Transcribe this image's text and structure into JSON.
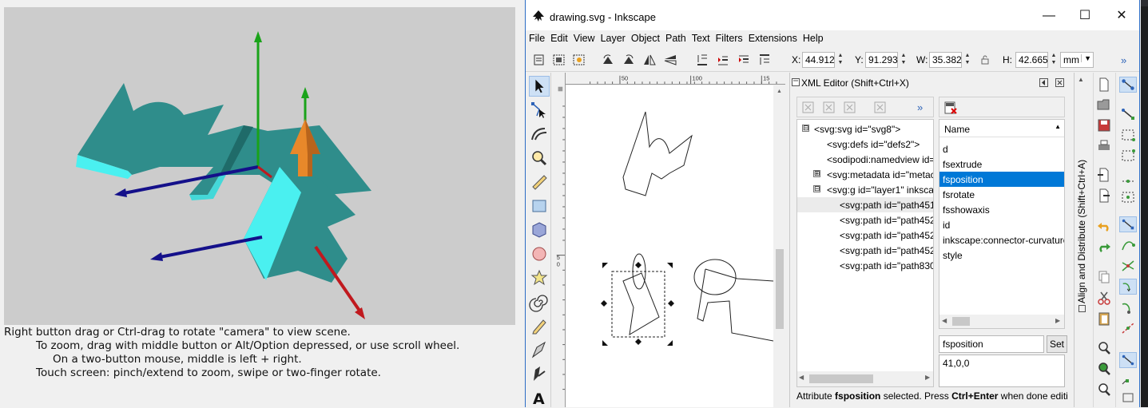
{
  "viewer": {
    "instructions": [
      "Right button drag or Ctrl-drag to rotate \"camera\" to view scene.",
      "To zoom, drag with middle button or Alt/Option depressed, or use scroll wheel.",
      "On a two-button mouse, middle is left + right.",
      "Touch screen: pinch/extend to zoom, swipe or two-finger rotate."
    ],
    "colors": {
      "background": "#cccccc",
      "shape_dark": "#2f8d8b",
      "shape_light": "#4af0f0",
      "x_axis": "#c0191e",
      "y_axis": "#1aa31a",
      "z_axis": "#14108a",
      "arrow": "#e8882a"
    }
  },
  "inkscape": {
    "title": "drawing.svg - Inkscape",
    "window_controls": {
      "minimize": "—",
      "maximize": "☐",
      "close": "✕"
    },
    "menu": [
      "File",
      "Edit",
      "View",
      "Layer",
      "Object",
      "Path",
      "Text",
      "Filters",
      "Extensions",
      "Help"
    ],
    "coords": {
      "x_label": "X:",
      "x_value": "44.912",
      "y_label": "Y:",
      "y_value": "91.293",
      "w_label": "W:",
      "w_value": "35.382",
      "h_label": "H:",
      "h_value": "42.665",
      "unit": "mm"
    },
    "ruler_h_labels": [
      "50",
      "100",
      "15"
    ],
    "ruler_v_labels": [
      "5",
      "0"
    ],
    "xml_editor": {
      "title": "XML Editor (Shift+Ctrl+X)",
      "tree": [
        {
          "text": "<svg:svg id=\"svg8\">",
          "expander": "⊟"
        },
        {
          "text": "<svg:defs id=\"defs2\">",
          "expander": ""
        },
        {
          "text": "<sodipodi:namedview id=",
          "expander": ""
        },
        {
          "text": "<svg:metadata id=\"metac",
          "expander": "⊞"
        },
        {
          "text": "<svg:g id=\"layer1\" inksca",
          "expander": "⊟"
        },
        {
          "text": "<svg:path id=\"path451",
          "expander": ""
        },
        {
          "text": "<svg:path id=\"path452",
          "expander": ""
        },
        {
          "text": "<svg:path id=\"path452",
          "expander": ""
        },
        {
          "text": "<svg:path id=\"path452",
          "expander": ""
        },
        {
          "text": "<svg:path id=\"path830",
          "expander": ""
        }
      ],
      "attr_header": "Name",
      "attributes": [
        "d",
        "fsextrude",
        "fsposition",
        "fsrotate",
        "fsshowaxis",
        "id",
        "inkscape:connector-curvature",
        "style"
      ],
      "selected_attribute": "fsposition",
      "attr_name_field": "fsposition",
      "set_button": "Set",
      "attr_value": "41,0,0",
      "status_prefix": "Attribute ",
      "status_attr": "fsposition",
      "status_mid": " selected. Press ",
      "status_keys": "Ctrl+Enter",
      "status_suffix": " when done editin"
    },
    "dock_tab": "Align and Distribute (Shift+Ctrl+A)",
    "more_glyph": "»"
  }
}
